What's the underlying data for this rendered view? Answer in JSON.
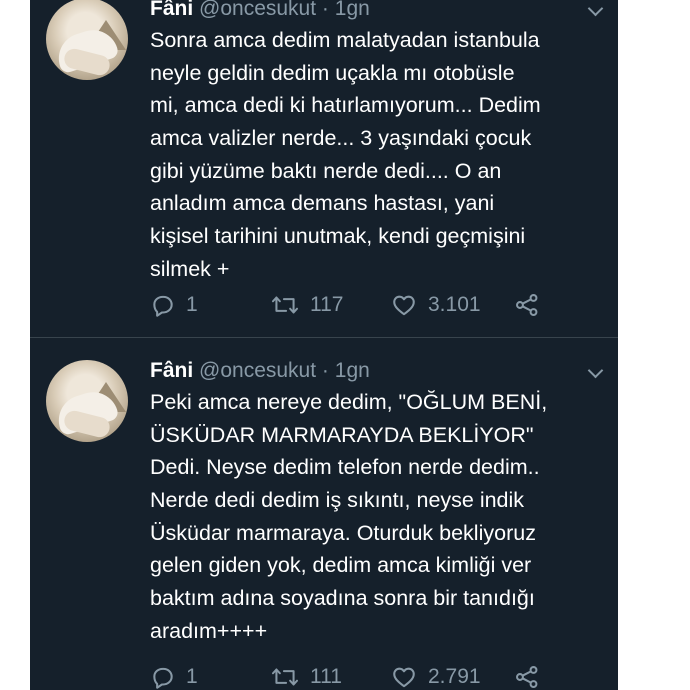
{
  "tweets": [
    {
      "name": "Fâni",
      "handle": "@oncesukut",
      "separator": "·",
      "time": "1gn",
      "lines": [
        "Sonra amca dedim malatyadan istanbula",
        "neyle geldin dedim uçakla mı otobüsle",
        "mi, amca dedi ki hatırlamıyorum... Dedim",
        "amca valizler nerde... 3 yaşındaki çocuk",
        "gibi yüzüme baktı nerde dedi.... O an",
        "anladım amca demans hastası, yani",
        "kişisel tarihini unutmak, kendi geçmişini",
        "silmek +"
      ],
      "replies": "1",
      "retweets": "117",
      "likes": "3.101"
    },
    {
      "name": "Fâni",
      "handle": "@oncesukut",
      "separator": "·",
      "time": "1gn",
      "lines": [
        "Peki amca nereye dedim, \"OĞLUM BENİ,",
        "ÜSKÜDAR MARMARAYDA BEKLİYOR\"",
        "Dedi. Neyse dedim telefon nerde dedim..",
        "Nerde dedi dedim iş sıkıntı, neyse indik",
        "Üsküdar marmaraya. Oturduk bekliyoruz",
        "gelen giden yok, dedim amca kimliği ver",
        "baktım adına soyadına sonra bir tanıdığı",
        "aradım++++"
      ],
      "replies": "1",
      "retweets": "111",
      "likes": "2.791"
    }
  ],
  "icons": {
    "reply": "reply-icon",
    "retweet": "retweet-icon",
    "like": "heart-icon",
    "share": "share-icon",
    "more": "chevron-down-icon"
  },
  "colors": {
    "background": "#15202b",
    "text": "#ffffff",
    "secondary": "#8899a6",
    "divider": "#38444d"
  }
}
